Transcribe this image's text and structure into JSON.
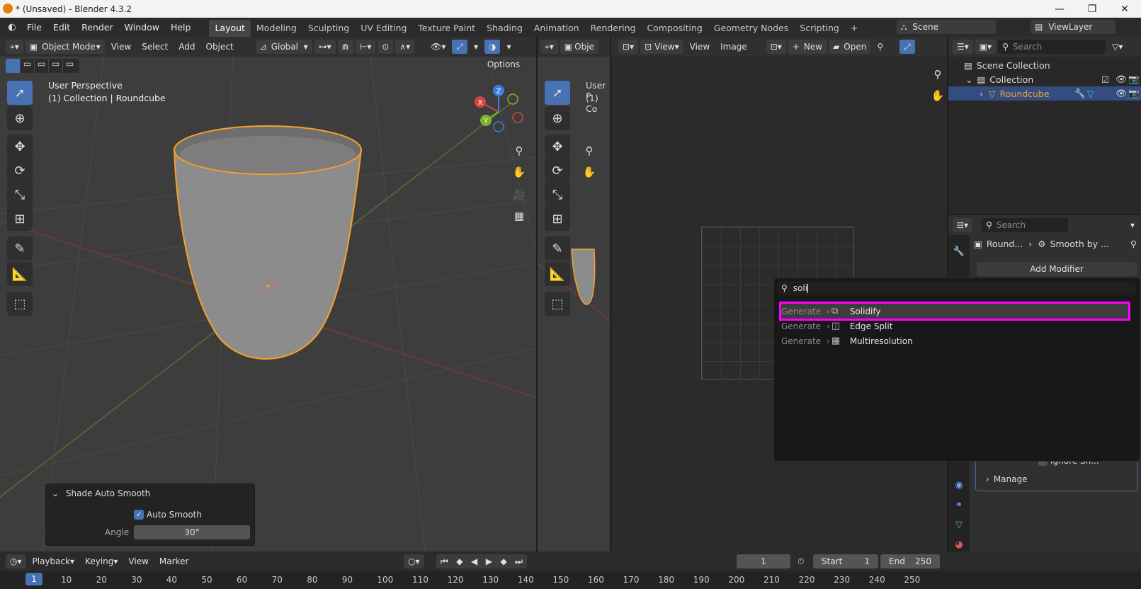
{
  "window": {
    "title": "* (Unsaved) - Blender 4.3.2",
    "minimize": "—",
    "maximize": "❐",
    "close": "✕"
  },
  "menu": [
    "File",
    "Edit",
    "Render",
    "Window",
    "Help"
  ],
  "workspaces": [
    "Layout",
    "Modeling",
    "Sculpting",
    "UV Editing",
    "Texture Paint",
    "Shading",
    "Animation",
    "Rendering",
    "Compositing",
    "Geometry Nodes",
    "Scripting"
  ],
  "workspace_active": "Layout",
  "add_workspace": "+",
  "scene": {
    "name": "Scene",
    "view_layer": "ViewLayer"
  },
  "viewport": {
    "mode": "Object Mode",
    "menus": [
      "View",
      "Select",
      "Add",
      "Object"
    ],
    "orientation": "Global",
    "options": "Options",
    "overlay_line1": "User Perspective",
    "overlay_line2": "(1) Collection | Roundcube",
    "axes": {
      "x": "X",
      "y": "Y",
      "z": "Z"
    }
  },
  "viewport2": {
    "mode": "Obje",
    "overlay_line1": "User P",
    "overlay_line2": "(1) Co"
  },
  "image_editor": {
    "view": "View",
    "menus": [
      "View",
      "Image"
    ],
    "new": "New",
    "open": "Open"
  },
  "outliner": {
    "search_placeholder": "Search",
    "items": [
      {
        "label": "Scene Collection"
      },
      {
        "label": "Collection"
      },
      {
        "label": "Roundcube"
      }
    ]
  },
  "properties": {
    "search_placeholder": "Search",
    "breadcrumb_object": "Round...",
    "breadcrumb_modifier": "Smooth by ...",
    "add_modifier": "Add Modifier",
    "ignore_sharp": "Ignore Sh...",
    "manage": "Manage"
  },
  "search_popup": {
    "query": "soli",
    "results": [
      {
        "category": "Generate",
        "name": "Solidify",
        "highlighted": true
      },
      {
        "category": "Generate",
        "name": "Edge Split",
        "highlighted": false
      },
      {
        "category": "Generate",
        "name": "Multiresolution",
        "highlighted": false
      }
    ],
    "highlight_color": "#ff00ff"
  },
  "redo_panel": {
    "title": "Shade Auto Smooth",
    "auto_smooth_label": "Auto Smooth",
    "auto_smooth_checked": true,
    "angle_label": "Angle",
    "angle_value": "30°"
  },
  "timeline": {
    "menus": [
      "Playback",
      "Keying",
      "View",
      "Marker"
    ],
    "current_frame": "1",
    "start_label": "Start",
    "start_value": "1",
    "end_label": "End",
    "end_value": "250",
    "ruler": [
      "1",
      "10",
      "20",
      "30",
      "40",
      "50",
      "60",
      "70",
      "80",
      "90",
      "100",
      "110",
      "120",
      "130",
      "140",
      "150",
      "160",
      "170",
      "180",
      "190",
      "200",
      "210",
      "220",
      "230",
      "240",
      "250"
    ]
  },
  "colors": {
    "accent": "#4772b3",
    "selection": "#f5a02a",
    "highlight": "#ff00ff"
  }
}
